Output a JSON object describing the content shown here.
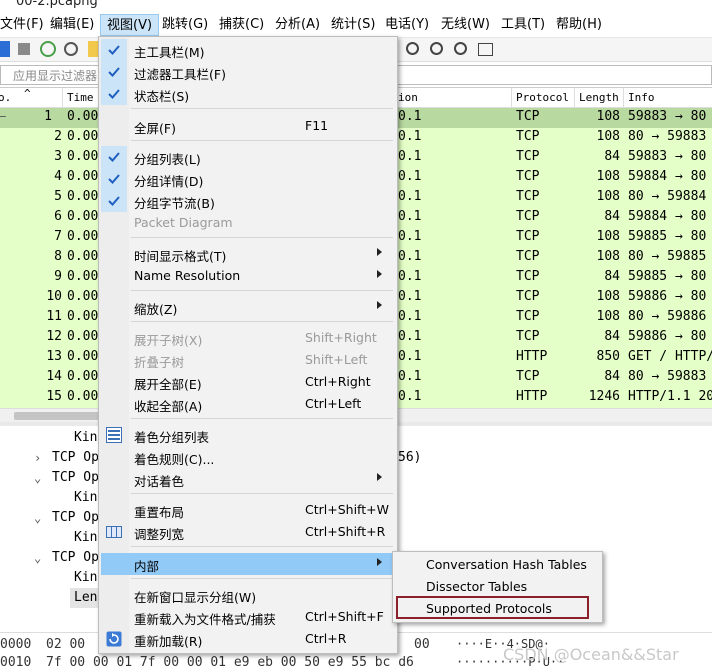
{
  "window": {
    "title": "00-2.pcapng"
  },
  "menubar": {
    "items": [
      {
        "label": "文件(F)"
      },
      {
        "label": "编辑(E)"
      },
      {
        "label": "视图(V)"
      },
      {
        "label": "跳转(G)"
      },
      {
        "label": "捕获(C)"
      },
      {
        "label": "分析(A)"
      },
      {
        "label": "统计(S)"
      },
      {
        "label": "电话(Y)"
      },
      {
        "label": "无线(W)"
      },
      {
        "label": "工具(T)"
      },
      {
        "label": "帮助(H)"
      }
    ]
  },
  "filter": {
    "placeholder": "应用显示过滤器"
  },
  "packet_list": {
    "headers": {
      "no": "o.",
      "time": "Time",
      "dest": "ion",
      "protocol": "Protocol",
      "length": "Length",
      "info": "Info"
    },
    "rows": [
      {
        "no": "1",
        "time": "0.00",
        "dest": "0.1",
        "protocol": "TCP",
        "length": "108",
        "info": "59883 → 80"
      },
      {
        "no": "2",
        "time": "0.00",
        "dest": "0.1",
        "protocol": "TCP",
        "length": "108",
        "info": "80 → 59883"
      },
      {
        "no": "3",
        "time": "0.00",
        "dest": "0.1",
        "protocol": "TCP",
        "length": "84",
        "info": "59883 → 80"
      },
      {
        "no": "4",
        "time": "0.00",
        "dest": "0.1",
        "protocol": "TCP",
        "length": "108",
        "info": "59884 → 80"
      },
      {
        "no": "5",
        "time": "0.00",
        "dest": "0.1",
        "protocol": "TCP",
        "length": "108",
        "info": "80 → 59884"
      },
      {
        "no": "6",
        "time": "0.00",
        "dest": "0.1",
        "protocol": "TCP",
        "length": "84",
        "info": "59884 → 80"
      },
      {
        "no": "7",
        "time": "0.00",
        "dest": "0.1",
        "protocol": "TCP",
        "length": "108",
        "info": "59885 → 80"
      },
      {
        "no": "8",
        "time": "0.00",
        "dest": "0.1",
        "protocol": "TCP",
        "length": "108",
        "info": "80 → 59885"
      },
      {
        "no": "9",
        "time": "0.00",
        "dest": "0.1",
        "protocol": "TCP",
        "length": "84",
        "info": "59885 → 80"
      },
      {
        "no": "10",
        "time": "0.00",
        "dest": "0.1",
        "protocol": "TCP",
        "length": "108",
        "info": "59886 → 80"
      },
      {
        "no": "11",
        "time": "0.00",
        "dest": "0.1",
        "protocol": "TCP",
        "length": "108",
        "info": "80 → 59886"
      },
      {
        "no": "12",
        "time": "0.00",
        "dest": "0.1",
        "protocol": "TCP",
        "length": "84",
        "info": "59886 → 80"
      },
      {
        "no": "13",
        "time": "0.00",
        "dest": "0.1",
        "protocol": "HTTP",
        "length": "850",
        "info": "GET / HTTP/"
      },
      {
        "no": "14",
        "time": "0.00",
        "dest": "0.1",
        "protocol": "TCP",
        "length": "84",
        "info": "80 → 59883"
      },
      {
        "no": "15",
        "time": "0.00",
        "dest": "0.1",
        "protocol": "HTTP",
        "length": "1246",
        "info": "HTTP/1.1 20"
      }
    ]
  },
  "details": {
    "lines": [
      {
        "text": "Kin"
      },
      {
        "text": "TCP Op"
      },
      {
        "text": "TCP Op"
      },
      {
        "text": "Kin"
      },
      {
        "text": "TCP Op"
      },
      {
        "text": "Kin"
      },
      {
        "text": "TCP Op"
      },
      {
        "text": "Kin"
      },
      {
        "text": "Len"
      }
    ],
    "tail": "56)"
  },
  "hex": {
    "line1": {
      "offset": "0000",
      "bytes": "02 00",
      "bytes_right": "00",
      "ascii": "····E··4·SD@·"
    },
    "line2": {
      "offset": "0010",
      "bytes": "7f 00 00 01 7f 00 00 01  e9 eb 00 50 e9 55 bc d6",
      "ascii": "··········P·U··"
    }
  },
  "view_menu": {
    "items": [
      {
        "label": "主工具栏(M)",
        "checked": true
      },
      {
        "label": "过滤器工具栏(F)",
        "checked": true
      },
      {
        "label": "状态栏(S)",
        "checked": true
      },
      {
        "label": "全屏(F)",
        "shortcut": "F11"
      },
      {
        "label": "分组列表(L)",
        "checked": true
      },
      {
        "label": "分组详情(D)",
        "checked": true
      },
      {
        "label": "分组字节流(B)",
        "checked": true
      },
      {
        "label": "Packet Diagram",
        "disabled": true
      },
      {
        "label": "时间显示格式(T)",
        "submenu": true
      },
      {
        "label": "Name Resolution",
        "submenu": true
      },
      {
        "label": "缩放(Z)",
        "submenu": true
      },
      {
        "label": "展开子树(X)",
        "shortcut": "Shift+Right",
        "disabled": true
      },
      {
        "label": "折叠子树",
        "shortcut": "Shift+Left",
        "disabled": true
      },
      {
        "label": "展开全部(E)",
        "shortcut": "Ctrl+Right"
      },
      {
        "label": "收起全部(A)",
        "shortcut": "Ctrl+Left"
      },
      {
        "label": "着色分组列表",
        "icon": "colorize-list-icon"
      },
      {
        "label": "着色规则(C)..."
      },
      {
        "label": "对话着色",
        "submenu": true
      },
      {
        "label": "重置布局",
        "shortcut": "Ctrl+Shift+W"
      },
      {
        "label": "调整列宽",
        "shortcut": "Ctrl+Shift+R",
        "icon": "resize-columns-icon"
      },
      {
        "label": "内部",
        "submenu": true,
        "highlighted": true
      },
      {
        "label": "在新窗口显示分组(W)"
      },
      {
        "label": "重新载入为文件格式/捕获",
        "shortcut": "Ctrl+Shift+F"
      },
      {
        "label": "重新加载(R)",
        "shortcut": "Ctrl+R",
        "icon": "reload-icon"
      }
    ]
  },
  "internals_submenu": {
    "items": [
      {
        "label": "Conversation Hash Tables"
      },
      {
        "label": "Dissector Tables"
      },
      {
        "label": "Supported Protocols",
        "highlighted_box": true
      }
    ]
  },
  "watermark": "CSDN @Ocean&&Star",
  "colors": {
    "row_bg": "#e4ffc7",
    "menu_highlight": "#91c9f7",
    "check_bg": "#cce4f7",
    "callout_box": "#8b1f2a"
  }
}
